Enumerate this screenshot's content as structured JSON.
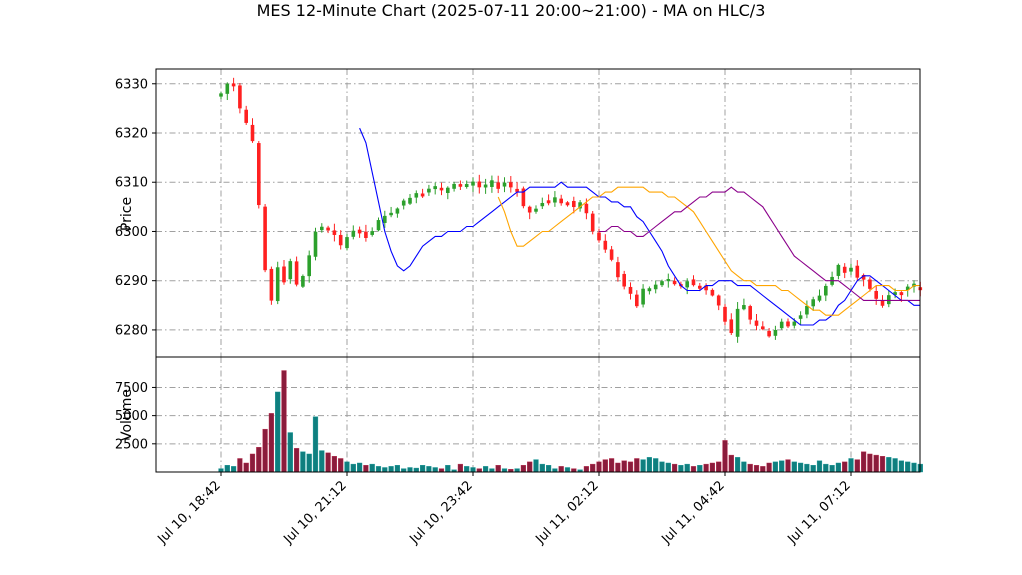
{
  "chart_data": {
    "type": "candlestick",
    "title": "MES 12-Minute Chart (2025-07-11 20:00~21:00) - MA on HLC/3",
    "price_panel": {
      "ylabel": "Price",
      "ylim": [
        6274.5,
        6333
      ],
      "yticks": [
        6280,
        6290,
        6300,
        6310,
        6320,
        6330
      ],
      "grid": true
    },
    "volume_panel": {
      "ylabel": "Volume",
      "ylim": [
        0,
        10200
      ],
      "yticks": [
        2500,
        5000,
        7500
      ],
      "grid": true
    },
    "x_axis": {
      "start": "2025-07-10 18:42",
      "interval_minutes": 12,
      "bar_count": 112,
      "ticks": [
        {
          "index": 0,
          "label": "Jul 10, 18:42"
        },
        {
          "index": 20,
          "label": "Jul 10, 21:12"
        },
        {
          "index": 40,
          "label": "Jul 10, 23:42"
        },
        {
          "index": 60,
          "label": "Jul 11, 02:12"
        },
        {
          "index": 80,
          "label": "Jul 11, 04:42"
        },
        {
          "index": 100,
          "label": "Jul 11, 07:12"
        }
      ]
    },
    "colors": {
      "up": "#2ca02c",
      "down": "#ff2020",
      "vol_up": "#0f7f7f",
      "vol_down": "#8b1c3c",
      "ma_fast": "#0000ff",
      "ma_mid": "#ffa500",
      "ma_slow": "#8b008b"
    },
    "close_path": [
      6328,
      6330,
      6330,
      6325,
      6322,
      6318,
      6305,
      6292,
      6286,
      6293,
      6290,
      6294,
      6289,
      6291,
      6295,
      6300,
      6301,
      6300,
      6299,
      6297,
      6299,
      6300,
      6300,
      6299,
      6300,
      6302,
      6303,
      6304,
      6305,
      6306,
      6307,
      6308,
      6308,
      6309,
      6309,
      6308,
      6309,
      6310,
      6309,
      6309,
      6310,
      6309,
      6309,
      6310,
      6309,
      6310,
      6309,
      6309,
      6305,
      6304,
      6305,
      6306,
      6306,
      6307,
      6306,
      6306,
      6305,
      6306,
      6304,
      6300,
      6298,
      6296,
      6294,
      6291,
      6289,
      6287,
      6285,
      6288,
      6288,
      6289,
      6290,
      6290,
      6289,
      6289,
      6290,
      6289,
      6289,
      6288,
      6287,
      6285,
      6282,
      6279,
      6284,
      6285,
      6282,
      6281,
      6280,
      6279,
      6280,
      6282,
      6281,
      6282,
      6283,
      6285,
      6286,
      6287,
      6289,
      6291,
      6293,
      6292,
      6293,
      6291,
      6290,
      6288,
      6286,
      6285,
      6287,
      6288,
      6288,
      6289,
      6289,
      6289
    ],
    "volume_profile": [
      300,
      600,
      500,
      1200,
      800,
      1600,
      2200,
      3800,
      5200,
      7100,
      9000,
      3500,
      2100,
      1800,
      1600,
      4900,
      1900,
      1700,
      1400,
      1200,
      900,
      700,
      800,
      600,
      700,
      500,
      400,
      500,
      600,
      300,
      400,
      350,
      600,
      500,
      400,
      300,
      600,
      200,
      700,
      500,
      400,
      300,
      500,
      300,
      600,
      300,
      250,
      300,
      600,
      900,
      1100,
      700,
      600,
      300,
      500,
      400,
      300,
      200,
      500,
      700,
      900,
      1100,
      1200,
      800,
      1000,
      900,
      1200,
      1100,
      1300,
      1200,
      900,
      800,
      700,
      600,
      700,
      500,
      600,
      700,
      800,
      900,
      2800,
      1500,
      1300,
      900,
      700,
      600,
      500,
      800,
      900,
      1000,
      1100,
      900,
      800,
      700,
      600,
      1000,
      700,
      600,
      800,
      900,
      1200,
      1100,
      1800,
      1600,
      1500,
      1400,
      1300,
      1200,
      1000,
      900,
      800,
      700
    ],
    "moving_averages": [
      {
        "color": "#0000ff",
        "values": [
          6321,
          6318,
          6312,
          6306,
          6300,
          6296,
          6293,
          6292,
          6293,
          6295,
          6297,
          6298,
          6299,
          6299,
          6300,
          6300,
          6300,
          6301,
          6301,
          6302,
          6303,
          6304,
          6305,
          6306,
          6307,
          6308,
          6308,
          6309,
          6309,
          6309,
          6309,
          6309,
          6310,
          6309,
          6309,
          6309,
          6309,
          6308,
          6307,
          6307,
          6306,
          6306,
          6305,
          6305,
          6303,
          6302,
          6300,
          6298,
          6296,
          6293,
          6291,
          6289,
          6288,
          6288,
          6288,
          6289,
          6289,
          6290,
          6290,
          6290,
          6289,
          6289,
          6289,
          6288,
          6287,
          6286,
          6285,
          6284,
          6283,
          6282,
          6281,
          6281,
          6281,
          6282,
          6282,
          6283,
          6285,
          6286,
          6288,
          6290,
          6291,
          6291,
          6290,
          6289,
          6288,
          6287,
          6286,
          6286,
          6285,
          6285
        ]
      },
      {
        "color": "#ffa500",
        "values": [
          6307,
          6304,
          6300,
          6297,
          6297,
          6298,
          6299,
          6300,
          6300,
          6301,
          6302,
          6303,
          6304,
          6305,
          6306,
          6307,
          6307,
          6308,
          6308,
          6309,
          6309,
          6309,
          6309,
          6309,
          6308,
          6308,
          6308,
          6307,
          6307,
          6306,
          6305,
          6304,
          6302,
          6300,
          6298,
          6296,
          6294,
          6292,
          6291,
          6290,
          6290,
          6289,
          6289,
          6289,
          6289,
          6288,
          6288,
          6287,
          6286,
          6285,
          6284,
          6284,
          6283,
          6283,
          6283,
          6284,
          6285,
          6286,
          6287,
          6288,
          6289,
          6289,
          6289,
          6288,
          6288,
          6288,
          6289,
          6289
        ]
      },
      {
        "color": "#8b008b",
        "values": [
          6300,
          6300,
          6301,
          6301,
          6300,
          6300,
          6299,
          6299,
          6300,
          6301,
          6302,
          6303,
          6304,
          6304,
          6305,
          6306,
          6307,
          6307,
          6308,
          6308,
          6308,
          6309,
          6308,
          6308,
          6307,
          6306,
          6305,
          6303,
          6301,
          6299,
          6297,
          6295,
          6294,
          6293,
          6292,
          6291,
          6290,
          6290,
          6290,
          6289,
          6288,
          6287,
          6286,
          6286,
          6286,
          6286,
          6286,
          6286,
          6286,
          6286,
          6286,
          6286
        ]
      }
    ]
  }
}
